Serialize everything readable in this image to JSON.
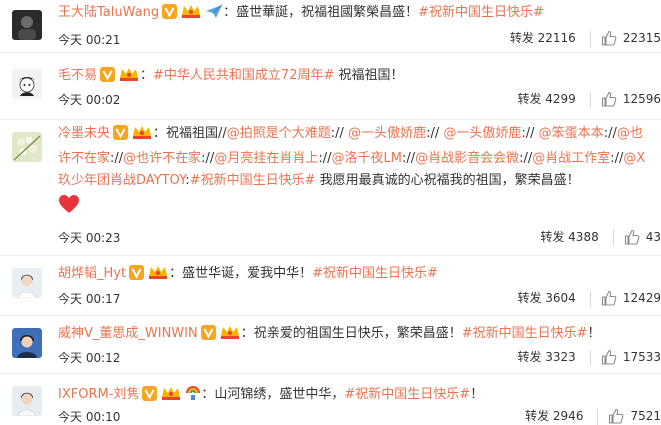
{
  "comments": [
    {
      "username": "王大陆TaluWang",
      "badges": [
        "verified-v-icon",
        "vip-crown-icon",
        "paper-plane-icon"
      ],
      "text_parts": [
        {
          "type": "text",
          "value": "："
        },
        {
          "type": "text",
          "value": "盛世華誕，祝福祖國繁榮昌盛！"
        },
        {
          "type": "topic",
          "value": "#祝新中国生日快乐#"
        }
      ],
      "time": "今天 00:21",
      "repost_label": "转发 22116",
      "likes": "22315"
    },
    {
      "username": "毛不易",
      "badges": [
        "verified-v-icon",
        "vip-crown-icon"
      ],
      "text_parts": [
        {
          "type": "text",
          "value": "："
        },
        {
          "type": "topic",
          "value": "#中华人民共和国成立72周年#"
        },
        {
          "type": "text",
          "value": " 祝福祖国！"
        }
      ],
      "time": "今天 00:02",
      "repost_label": "转发 4299",
      "likes": "12596"
    },
    {
      "username": "冷墨未央",
      "badges": [
        "verified-v-icon",
        "vip-crown-icon"
      ],
      "text_parts": [
        {
          "type": "text",
          "value": "：祝福祖国//"
        },
        {
          "type": "mention",
          "value": "@拍照是个大难题"
        },
        {
          "type": "text",
          "value": ":// "
        },
        {
          "type": "mention",
          "value": "@一头傲娇鹿"
        },
        {
          "type": "text",
          "value": ":// "
        },
        {
          "type": "mention",
          "value": "@一头傲娇鹿"
        },
        {
          "type": "text",
          "value": ":// "
        },
        {
          "type": "mention",
          "value": "@笨蛋本本"
        },
        {
          "type": "text",
          "value": "://"
        },
        {
          "type": "mention",
          "value": "@也许不在家"
        },
        {
          "type": "text",
          "value": "://"
        },
        {
          "type": "mention",
          "value": "@也许不在家"
        },
        {
          "type": "text",
          "value": "://"
        },
        {
          "type": "mention",
          "value": "@月亮挂在肖肖上"
        },
        {
          "type": "text",
          "value": "://"
        },
        {
          "type": "mention",
          "value": "@洛千夜LM"
        },
        {
          "type": "text",
          "value": "://"
        },
        {
          "type": "mention",
          "value": "@肖战影音会会微"
        },
        {
          "type": "text",
          "value": "://"
        },
        {
          "type": "mention",
          "value": "@肖战工作室"
        },
        {
          "type": "text",
          "value": "://"
        },
        {
          "type": "mention",
          "value": "@X玖少年团肖战DAYTOY"
        },
        {
          "type": "text",
          "value": ":"
        },
        {
          "type": "topic",
          "value": "#祝新中国生日快乐#"
        },
        {
          "type": "text",
          "value": " 我愿用最真诚的心祝福我的祖国，繁荣昌盛！"
        }
      ],
      "emoji": "red-heart-icon",
      "time": "今天 00:23",
      "repost_label": "转发 4388",
      "likes": "43"
    },
    {
      "username": "胡烨韬_Hyt",
      "badges": [
        "verified-v-icon",
        "vip-crown-icon"
      ],
      "text_parts": [
        {
          "type": "text",
          "value": "：盛世华诞，爱我中华！"
        },
        {
          "type": "topic",
          "value": "#祝新中国生日快乐#"
        }
      ],
      "time": "今天 00:17",
      "repost_label": "转发 3604",
      "likes": "12429"
    },
    {
      "username": "威神V_董思成_WINWIN",
      "badges": [
        "verified-v-icon",
        "vip-crown-icon"
      ],
      "text_parts": [
        {
          "type": "text",
          "value": "：祝亲爱的祖国生日快乐，繁荣昌盛！"
        },
        {
          "type": "topic",
          "value": "#祝新中国生日快乐#"
        },
        {
          "type": "text",
          "value": "！"
        }
      ],
      "time": "今天 00:12",
      "repost_label": "转发 3323",
      "likes": "17533"
    },
    {
      "username": "IXFORM-刘隽",
      "badges": [
        "verified-v-icon",
        "vip-crown-icon",
        "rainbow-medal-icon"
      ],
      "text_parts": [
        {
          "type": "text",
          "value": "：山河锦绣，盛世中华，"
        },
        {
          "type": "topic",
          "value": "#祝新中国生日快乐#"
        },
        {
          "type": "text",
          "value": "！"
        }
      ],
      "time": "今天 00:10",
      "repost_label": "转发 2946",
      "likes": "7521"
    }
  ],
  "colors": {
    "link": "#eb7350",
    "text": "#333333",
    "verified_badge": "#f5a623",
    "divider": "#eeeeee"
  }
}
